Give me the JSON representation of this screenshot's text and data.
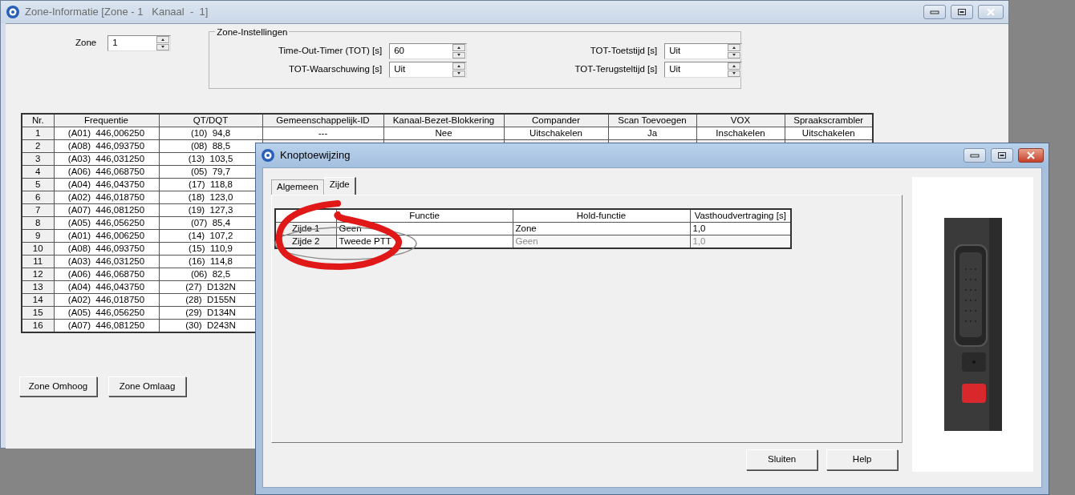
{
  "main_window": {
    "title": "Zone-Informatie [Zone - 1   Kanaal  -  1]",
    "zone": {
      "label": "Zone",
      "value": "1"
    },
    "zone_settings": {
      "title": "Zone-Instellingen",
      "fields": [
        {
          "label": "Time-Out-Timer (TOT) [s]",
          "value": "60"
        },
        {
          "label": "TOT-Toetstijd [s]",
          "value": "Uit"
        },
        {
          "label": "TOT-Waarschuwing [s]",
          "value": "Uit"
        },
        {
          "label": "TOT-Terugsteltijd [s]",
          "value": "Uit"
        }
      ]
    },
    "table": {
      "columns": [
        "Nr.",
        "Frequentie",
        "QT/DQT",
        "Gemeenschappelijk-ID",
        "Kanaal-Bezet-Blokkering",
        "Compander",
        "Scan Toevoegen",
        "VOX",
        "Spraakscrambler"
      ],
      "rows": [
        [
          "1",
          "(A01)  446,006250",
          "(10)  94,8",
          "---",
          "Nee",
          "Uitschakelen",
          "Ja",
          "Inschakelen",
          "Uitschakelen"
        ],
        [
          "2",
          "(A08)  446,093750",
          "(08)  88,5"
        ],
        [
          "3",
          "(A03)  446,031250",
          "(13)  103,5"
        ],
        [
          "4",
          "(A06)  446,068750",
          "(05)  79,7"
        ],
        [
          "5",
          "(A04)  446,043750",
          "(17)  118,8"
        ],
        [
          "6",
          "(A02)  446,018750",
          "(18)  123,0"
        ],
        [
          "7",
          "(A07)  446,081250",
          "(19)  127,3"
        ],
        [
          "8",
          "(A05)  446,056250",
          "(07)  85,4"
        ],
        [
          "9",
          "(A01)  446,006250",
          "(14)  107,2"
        ],
        [
          "10",
          "(A08)  446,093750",
          "(15)  110,9"
        ],
        [
          "11",
          "(A03)  446,031250",
          "(16)  114,8"
        ],
        [
          "12",
          "(A06)  446,068750",
          "(06)  82,5"
        ],
        [
          "13",
          "(A04)  446,043750",
          "(27)  D132N"
        ],
        [
          "14",
          "(A02)  446,018750",
          "(28)  D155N"
        ],
        [
          "15",
          "(A05)  446,056250",
          "(29)  D134N"
        ],
        [
          "16",
          "(A07)  446,081250",
          "(30)  D243N"
        ]
      ]
    },
    "buttons": [
      "Zone Omhoog",
      "Zone Omlaag"
    ]
  },
  "dialog": {
    "title": "Knoptoewijzing",
    "tabs": [
      {
        "label": "Algemeen",
        "selected": false
      },
      {
        "label": "Zijde",
        "selected": true
      }
    ],
    "table": {
      "columns": [
        "Functie",
        "Hold-functie",
        "Vasthoudvertraging [s]"
      ],
      "rows": [
        {
          "key": "Zijde 1",
          "function": "Geen",
          "hold_function": "Zone",
          "delay": "1,0",
          "disabled": false
        },
        {
          "key": "Zijde 2",
          "function": "Tweede PTT",
          "hold_function": "Geen",
          "delay": "1,0",
          "disabled": true
        }
      ]
    },
    "buttons": [
      "Sluiten",
      "Help"
    ]
  }
}
